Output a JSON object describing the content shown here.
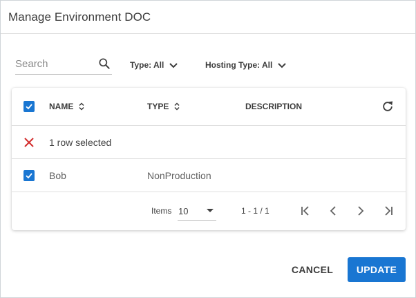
{
  "dialog": {
    "title": "Manage Environment DOC"
  },
  "search": {
    "placeholder": "Search",
    "value": ""
  },
  "filters": {
    "type_label": "Type: All",
    "hosting_label": "Hosting Type: All"
  },
  "table": {
    "columns": {
      "name": "NAME",
      "type": "TYPE",
      "description": "DESCRIPTION"
    },
    "header_checkbox_checked": true,
    "selection_text": "1 row selected",
    "rows": [
      {
        "name": "Bob",
        "type": "NonProduction",
        "description": "",
        "checked": true
      }
    ]
  },
  "pagination": {
    "items_label": "Items",
    "items_per_page": "10",
    "range": "1 - 1 / 1"
  },
  "actions": {
    "cancel": "CANCEL",
    "update": "UPDATE"
  },
  "icons": {
    "search": "search-icon",
    "chevron": "chevron-down-icon",
    "sort": "sort-icon",
    "refresh": "refresh-icon",
    "clear": "close-icon",
    "checkbox": "checkbox-checked-icon",
    "first": "first-page-icon",
    "prev": "chevron-left-icon",
    "next": "chevron-right-icon",
    "last": "last-page-icon"
  },
  "colors": {
    "primary": "#1976d2",
    "clear": "#d32f2f",
    "text": "#3c3c3c",
    "muted": "#616161",
    "divider": "#e0e0e0"
  }
}
